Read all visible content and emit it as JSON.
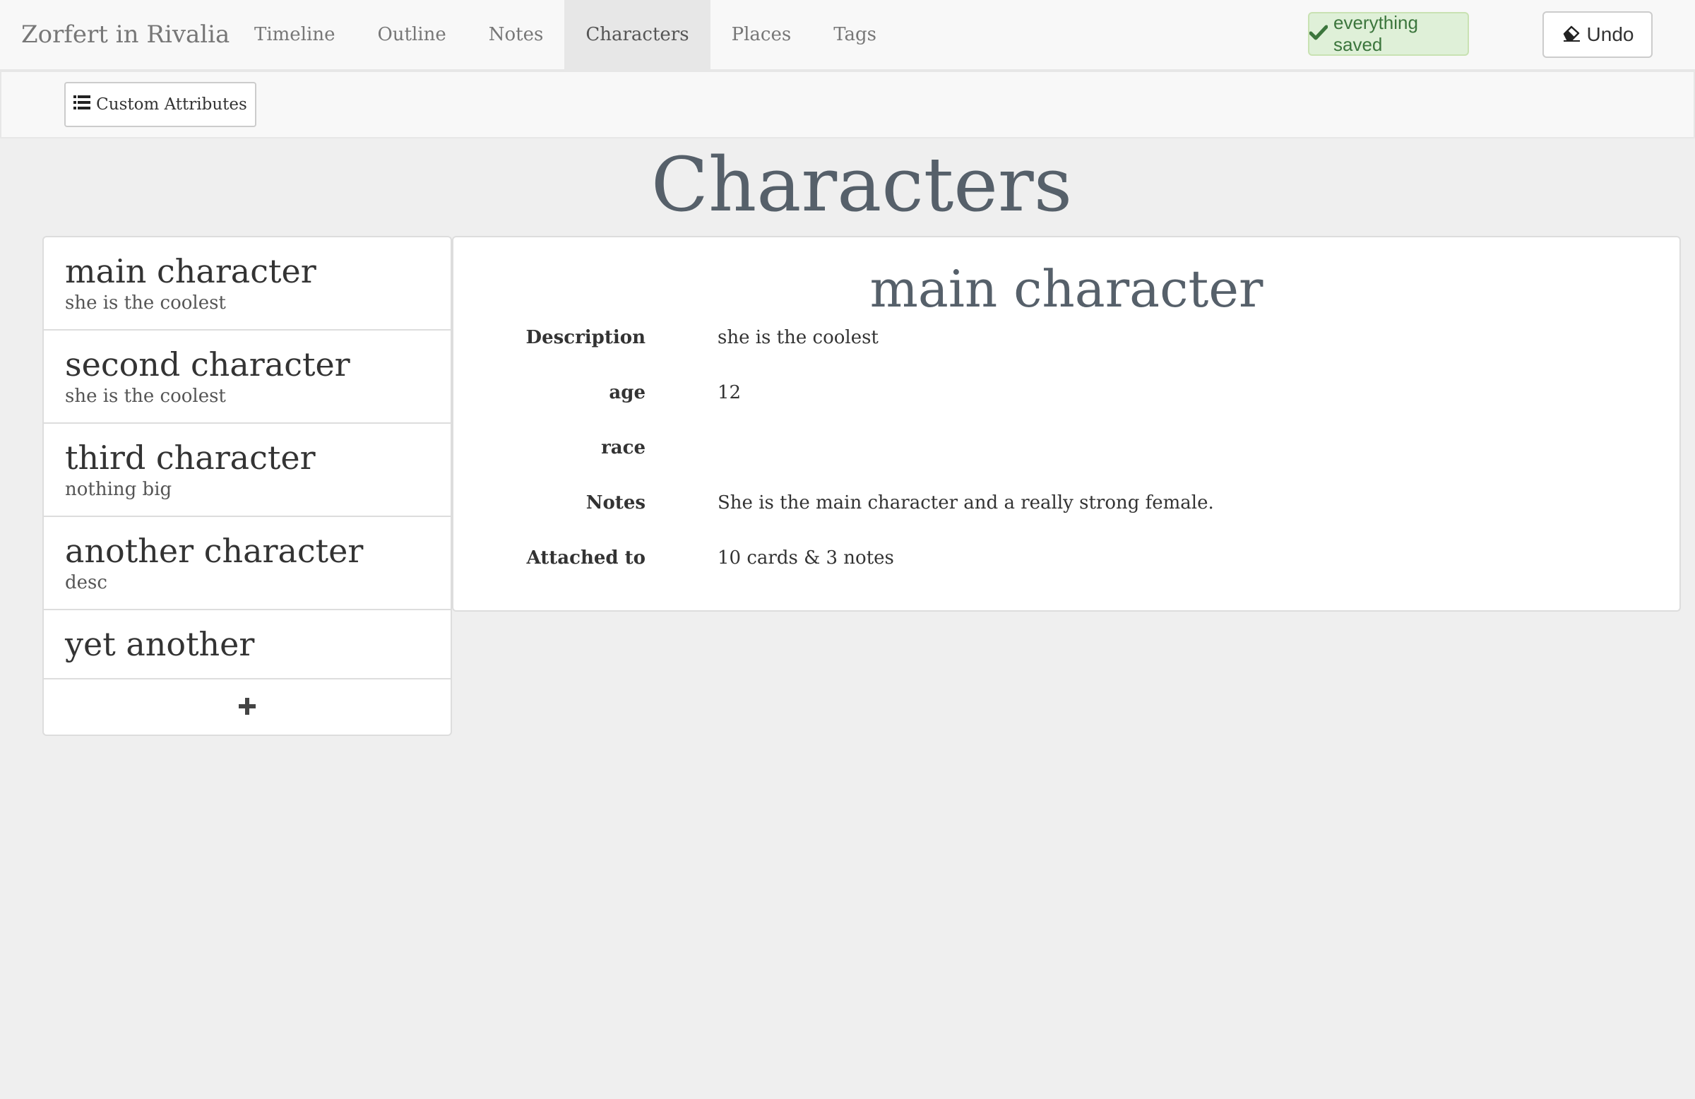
{
  "app": {
    "title": "Zorfert in Rivalia"
  },
  "nav": {
    "tabs": [
      {
        "label": "Timeline"
      },
      {
        "label": "Outline"
      },
      {
        "label": "Notes"
      },
      {
        "label": "Characters",
        "active": true
      },
      {
        "label": "Places"
      },
      {
        "label": "Tags"
      }
    ]
  },
  "status": {
    "saved_label": "everything saved",
    "icon": "check-icon",
    "color": "#3c763d"
  },
  "toolbar": {
    "undo_label": "Undo",
    "undo_icon": "eraser-icon",
    "custom_attributes_label": "Custom Attributes",
    "custom_attributes_icon": "list-icon"
  },
  "page": {
    "title": "Characters"
  },
  "characters": [
    {
      "name": "main character",
      "description": "she is the coolest"
    },
    {
      "name": "second character",
      "description": "she is the coolest"
    },
    {
      "name": "third character",
      "description": "nothing big"
    },
    {
      "name": "another character",
      "description": "desc"
    },
    {
      "name": "yet another",
      "description": ""
    }
  ],
  "add_button": {
    "icon": "plus-icon"
  },
  "detail": {
    "name": "main character",
    "attributes": [
      {
        "label": "Description",
        "value": "she is the coolest"
      },
      {
        "label": "age",
        "value": "12"
      },
      {
        "label": "race",
        "value": ""
      },
      {
        "label": "Notes",
        "value": "She is the main character and a really strong female."
      },
      {
        "label": "Attached to",
        "value": "10 cards & 3 notes"
      }
    ]
  }
}
